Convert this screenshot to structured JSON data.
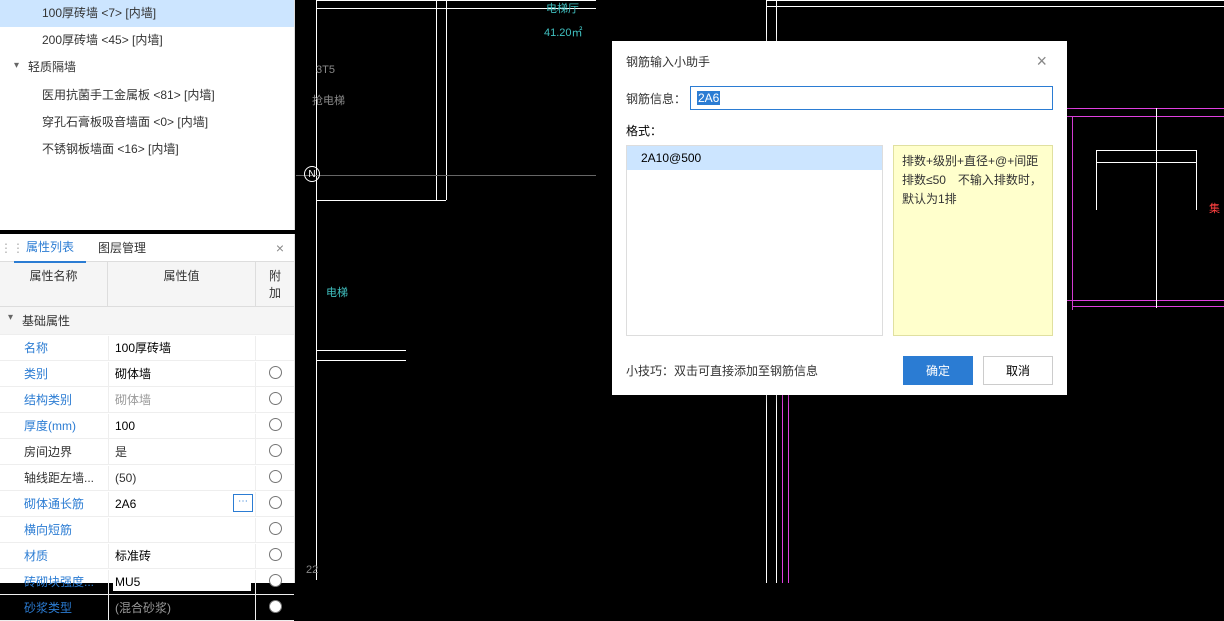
{
  "tree": {
    "items": [
      {
        "label": "100厚砖墙 <7> [内墙]",
        "selected": true,
        "level": "leaf"
      },
      {
        "label": "200厚砖墙 <45> [内墙]",
        "selected": false,
        "level": "leaf"
      },
      {
        "label": "轻质隔墙",
        "selected": false,
        "level": "category"
      },
      {
        "label": "医用抗菌手工金属板 <81> [内墙]",
        "selected": false,
        "level": "leaf"
      },
      {
        "label": "穿孔石膏板吸音墙面 <0> [内墙]",
        "selected": false,
        "level": "leaf"
      },
      {
        "label": "不锈钢板墙面 <16> [内墙]",
        "selected": false,
        "level": "leaf"
      }
    ]
  },
  "propPanel": {
    "tabs": {
      "active": "属性列表",
      "other": "图层管理"
    },
    "header": {
      "name": "属性名称",
      "value": "属性值",
      "extra": "附加"
    },
    "group": "基础属性",
    "rows": [
      {
        "name": "名称",
        "value": "100厚砖墙",
        "link": true,
        "input": true,
        "radio": false
      },
      {
        "name": "类别",
        "value": "砌体墙",
        "link": true,
        "input": true,
        "radio": true
      },
      {
        "name": "结构类别",
        "value": "砌体墙",
        "link": true,
        "input": false,
        "disabled": true,
        "radio": true
      },
      {
        "name": "厚度(mm)",
        "value": "100",
        "link": true,
        "input": true,
        "radio": true
      },
      {
        "name": "房间边界",
        "value": "是",
        "link": false,
        "input": false,
        "radio": true
      },
      {
        "name": "轴线距左墙...",
        "value": "(50)",
        "link": false,
        "input": false,
        "radio": true
      },
      {
        "name": "砌体通长筋",
        "value": "2A6",
        "link": true,
        "input": true,
        "more": true,
        "radio": true
      },
      {
        "name": "横向短筋",
        "value": "",
        "link": true,
        "input": true,
        "radio": true
      },
      {
        "name": "材质",
        "value": "标准砖",
        "link": true,
        "input": true,
        "radio": true
      },
      {
        "name": "砖砌块强度...",
        "value": "MU5",
        "link": true,
        "input": true,
        "radio": true
      },
      {
        "name": "砂浆类型",
        "value": "(混合砂浆)",
        "link": true,
        "input": false,
        "disabled": true,
        "radio": true
      }
    ]
  },
  "dialog": {
    "title": "钢筋输入小助手",
    "fieldLabel": "钢筋信息：",
    "fieldValue": "2A6",
    "formatLabel": "格式：",
    "formatItems": [
      {
        "label": "2A10@500",
        "selected": true
      }
    ],
    "hint": "排数+级别+直径+@+间距排数≤50　不输入排数时，默认为1排",
    "footerTip": "小技巧：双击可直接添加至钢筋信息",
    "ok": "确定",
    "cancel": "取消"
  },
  "cad": {
    "dim1": "41.20㎡",
    "label1": "电梯厅",
    "label2": "抢电梯",
    "label3": "电梯",
    "north": "N",
    "bt5": "3T5",
    "num22": "22",
    "jixie": "集"
  }
}
